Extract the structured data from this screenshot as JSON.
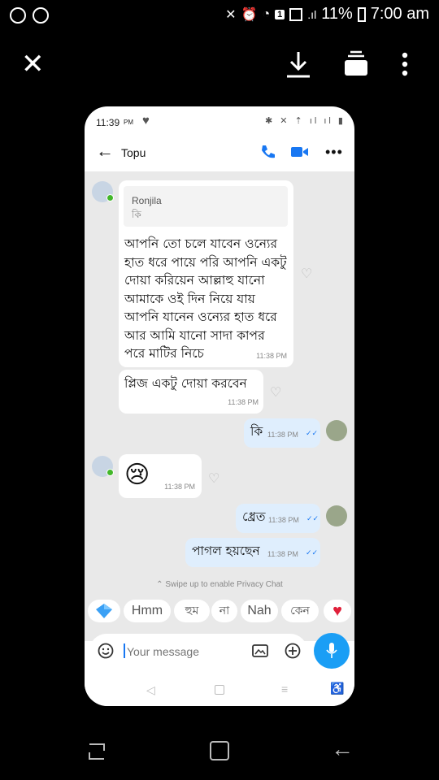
{
  "status_bar": {
    "battery": "11%",
    "time": "7:00 am",
    "badge": "1"
  },
  "phone": {
    "status_time": "11:39",
    "status_ampm": "PM",
    "contact_name": "Topu",
    "messages": [
      {
        "quote_name": "Ronjila",
        "quote_text": "কি",
        "text": "আপনি তো চলে যাবেন ওন্যের হাত ধরে পায়ে পরি আপনি একটু দোয়া করিয়েন আল্লাহু যানো আমাকে ওই দিন নিয়ে যায় আপনি যানেন ওন্যের হাত ধরে আর আমি যানো সাদা কাপর পরে মাটির নিচে",
        "time": "11:38 PM"
      },
      {
        "text": "প্লিজ একটু দোয়া করবেন",
        "time": "11:38 PM"
      },
      {
        "text": "কি",
        "time": "11:38 PM"
      },
      {
        "text": "😢",
        "time": "11:38 PM"
      },
      {
        "text": "ধ্রেত",
        "time": "11:38 PM"
      },
      {
        "text": "পাগল হয়ছেন",
        "time": "11:38 PM"
      }
    ],
    "privacy_hint": "Swipe up to enable Privacy Chat",
    "quick_replies": [
      "Hmm",
      "হুম",
      "না",
      "Nah",
      "কেন"
    ],
    "composer_placeholder": "Your message"
  }
}
